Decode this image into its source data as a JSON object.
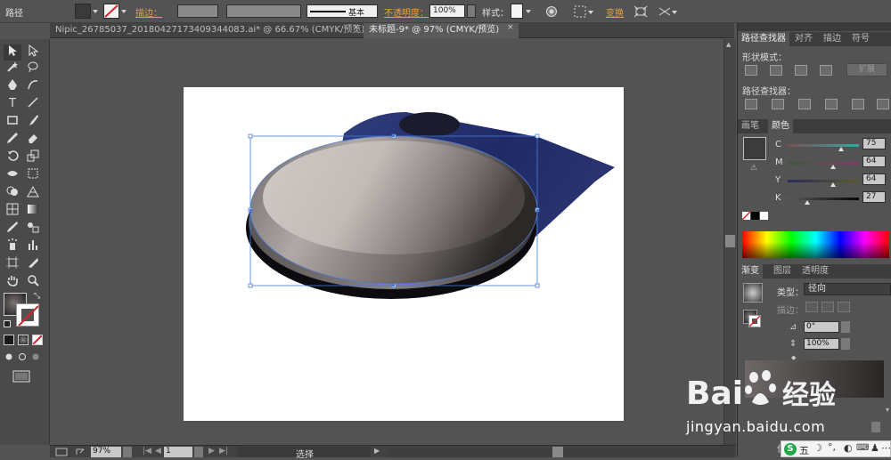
{
  "control_bar": {
    "object_type": "路径",
    "stroke_label": "描边：",
    "stroke_style_label": "基本",
    "opacity_label": "不透明度：",
    "opacity_value": "100%",
    "style_label": "样式：",
    "transform_label": "变换"
  },
  "tabs": [
    {
      "label": "Nipic_26785037_20180427173409344083.ai* @ 66.67% (CMYK/预览)",
      "close": "×"
    },
    {
      "label": "未标题-9* @ 97% (CMYK/预览)",
      "close": "×"
    }
  ],
  "status_bar": {
    "zoom": "97%",
    "artboard_number": "1",
    "tool_status": "选择"
  },
  "pathfinder_panel": {
    "tabs": [
      "路径查找器",
      "对齐",
      "描边",
      "符号"
    ],
    "shape_modes_label": "形状模式：",
    "expand_label": "扩展",
    "pathfinders_label": "路径查找器："
  },
  "color_panel": {
    "tabs": [
      "画笔",
      "颜色"
    ],
    "channels": [
      {
        "name": "C",
        "value": "75",
        "fraction": 0.75
      },
      {
        "name": "M",
        "value": "64",
        "fraction": 0.64
      },
      {
        "name": "Y",
        "value": "64",
        "fraction": 0.64
      },
      {
        "name": "K",
        "value": "27",
        "fraction": 0.27
      }
    ]
  },
  "gradient_panel": {
    "tabs": [
      "渐变",
      "图层",
      "透明度"
    ],
    "type_label": "类型：",
    "type_value": "径向",
    "stroke_label": "描边：",
    "angle_value": "0°",
    "aspect_value": "100%",
    "location_label": "位"
  },
  "watermark": {
    "brand": "Bai",
    "brand_suffix": "经验",
    "url": "jingyan.baidu.com"
  },
  "ime": {
    "label": "五"
  },
  "colors": {
    "ui_bg": "#535353",
    "highlight_orange": "#e8a23a",
    "selection_blue": "#4a7bd6",
    "shadow_navy": "#1f2a66"
  }
}
